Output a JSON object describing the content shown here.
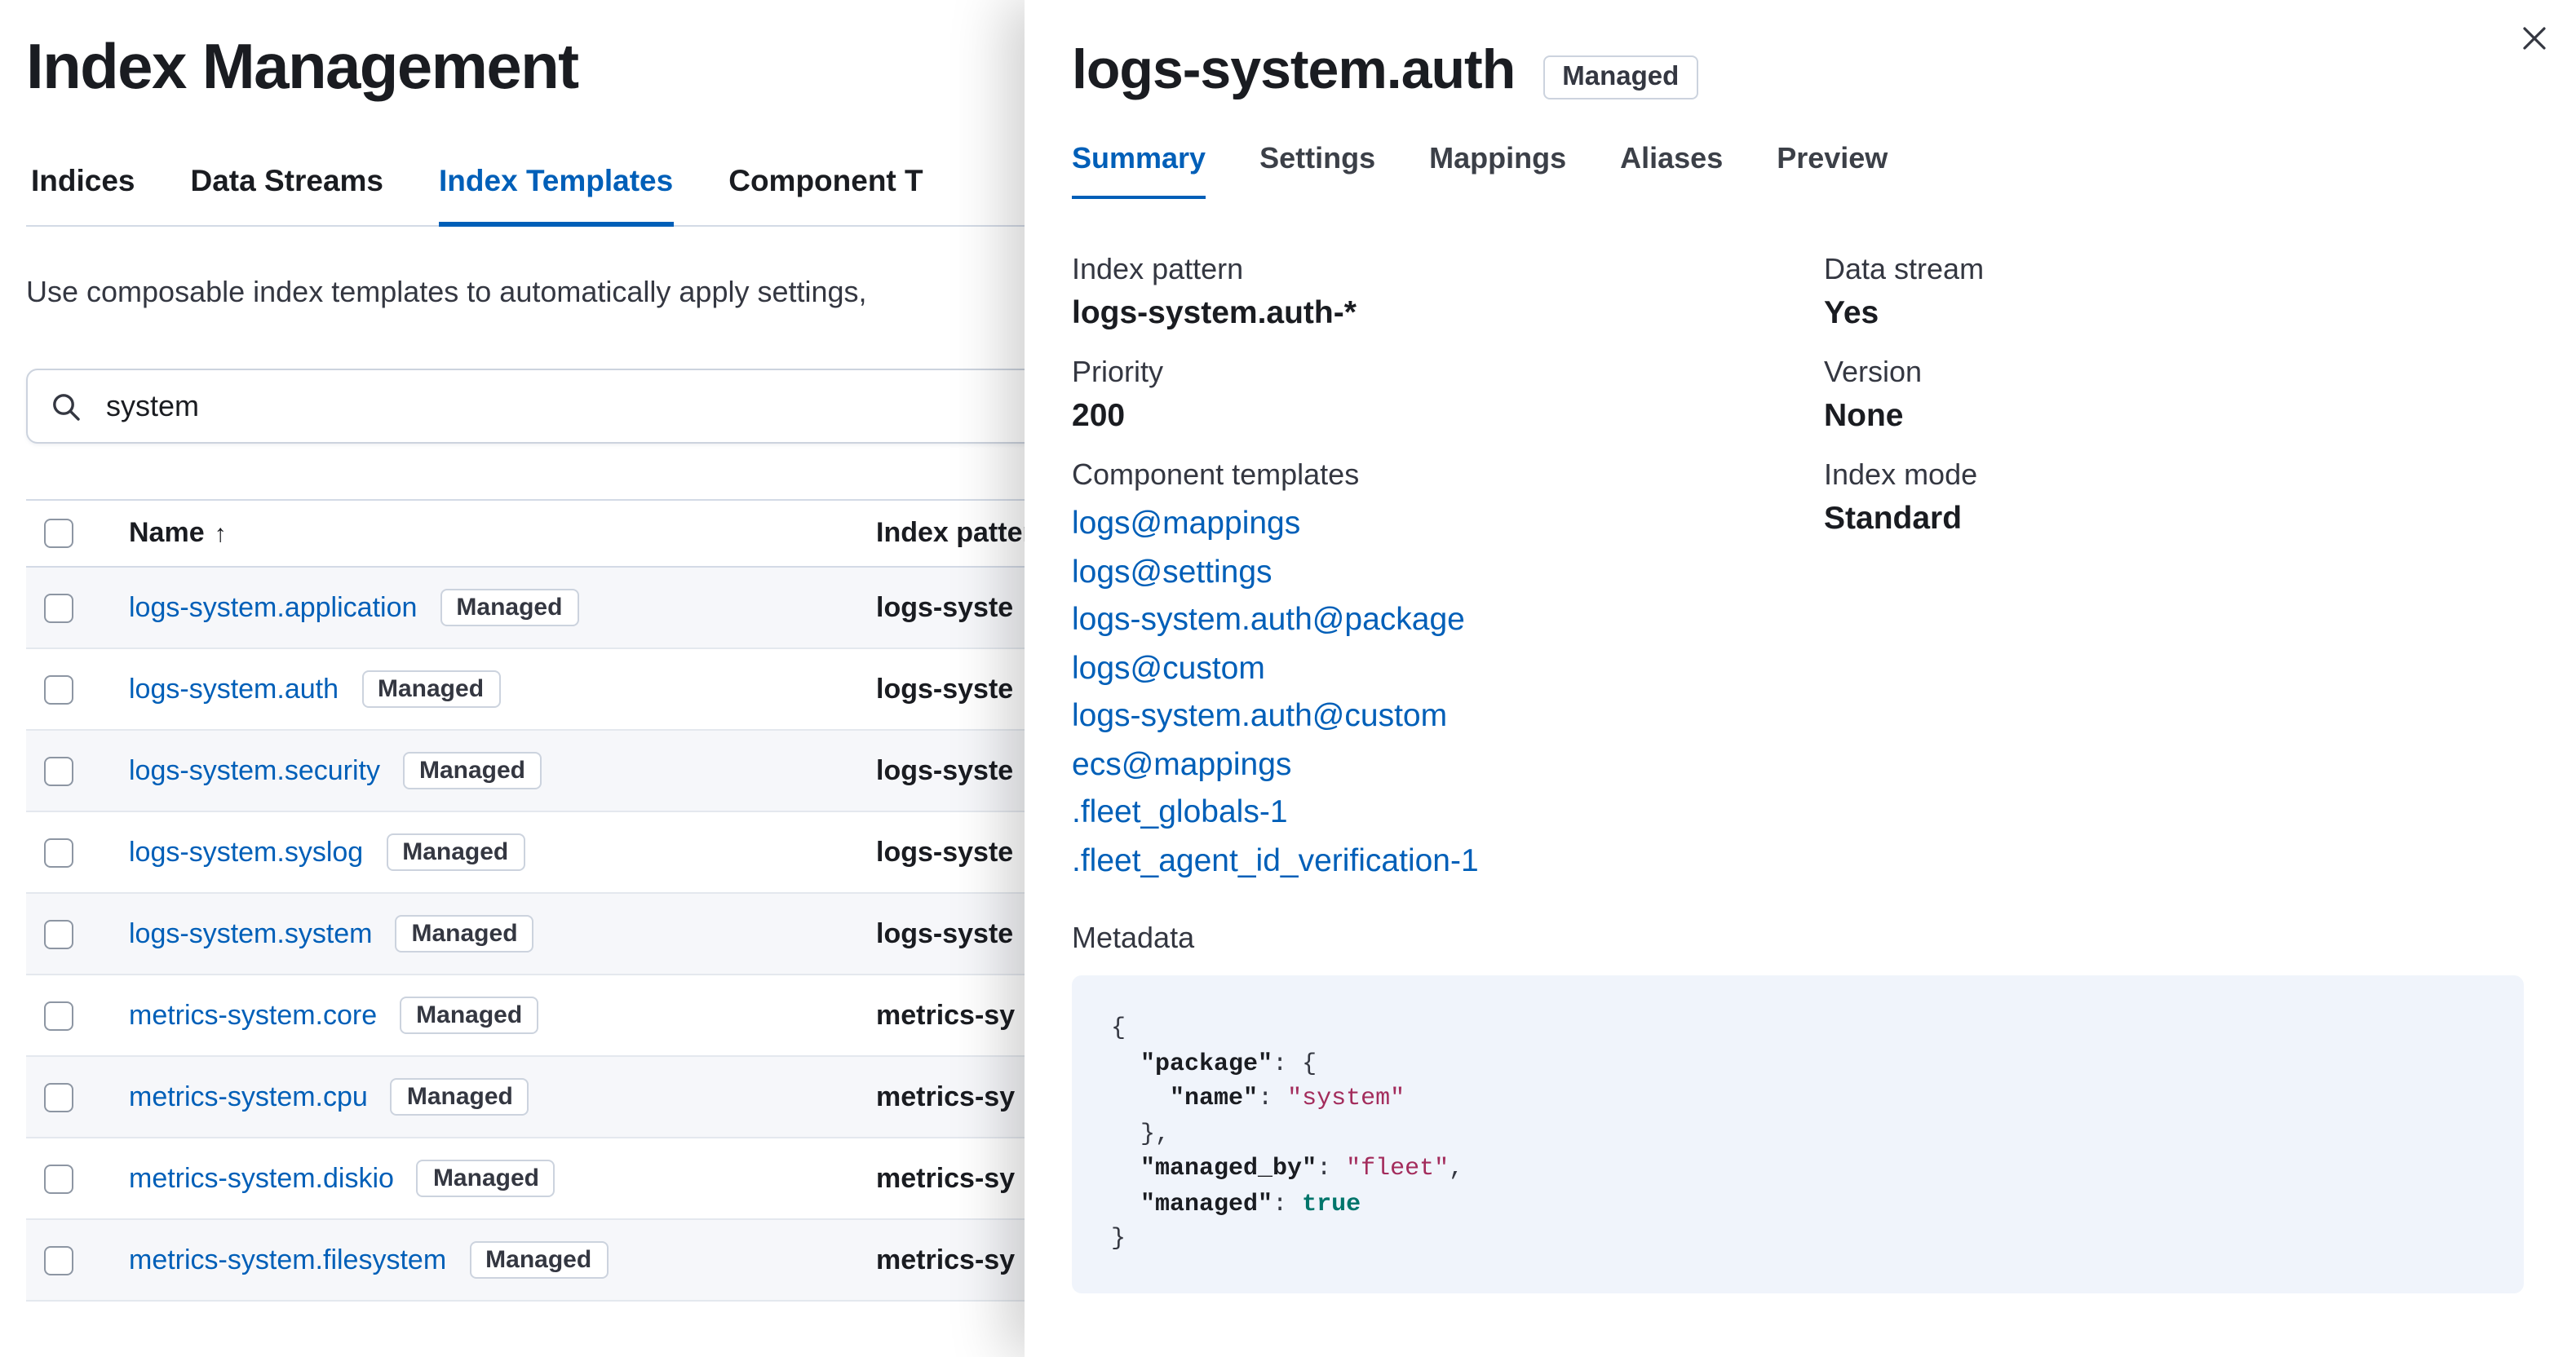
{
  "colors": {
    "accent": "#005fb8",
    "text": "#1a1c21",
    "subdued": "#343741",
    "border": "#d3dae6",
    "badge-border": "#ccd3de",
    "code-bg": "#f0f4fb",
    "code-str": "#a32c5c",
    "code-bool": "#00756b"
  },
  "page": {
    "title": "Index Management",
    "tabs": [
      {
        "label": "Indices"
      },
      {
        "label": "Data Streams"
      },
      {
        "label": "Index Templates"
      },
      {
        "label": "Component T"
      }
    ],
    "description": "Use composable index templates to automatically apply settings,",
    "search": {
      "value": "system"
    },
    "table": {
      "headers": {
        "name": "Name",
        "pattern": "Index patter"
      },
      "rows": [
        {
          "name": "logs-system.application",
          "badge": "Managed",
          "pattern": "logs-syste"
        },
        {
          "name": "logs-system.auth",
          "badge": "Managed",
          "pattern": "logs-syste"
        },
        {
          "name": "logs-system.security",
          "badge": "Managed",
          "pattern": "logs-syste"
        },
        {
          "name": "logs-system.syslog",
          "badge": "Managed",
          "pattern": "logs-syste"
        },
        {
          "name": "logs-system.system",
          "badge": "Managed",
          "pattern": "logs-syste"
        },
        {
          "name": "metrics-system.core",
          "badge": "Managed",
          "pattern": "metrics-sy"
        },
        {
          "name": "metrics-system.cpu",
          "badge": "Managed",
          "pattern": "metrics-sy"
        },
        {
          "name": "metrics-system.diskio",
          "badge": "Managed",
          "pattern": "metrics-sy"
        },
        {
          "name": "metrics-system.filesystem",
          "badge": "Managed",
          "pattern": "metrics-sy"
        }
      ]
    }
  },
  "flyout": {
    "title": "logs-system.auth",
    "badge": "Managed",
    "tabs": [
      {
        "label": "Summary"
      },
      {
        "label": "Settings"
      },
      {
        "label": "Mappings"
      },
      {
        "label": "Aliases"
      },
      {
        "label": "Preview"
      }
    ],
    "summary": {
      "index_pattern_label": "Index pattern",
      "index_pattern_value": "logs-system.auth-*",
      "priority_label": "Priority",
      "priority_value": "200",
      "component_templates_label": "Component templates",
      "component_templates": [
        "logs@mappings",
        "logs@settings",
        "logs-system.auth@package",
        "logs@custom",
        "logs-system.auth@custom",
        "ecs@mappings",
        ".fleet_globals-1",
        ".fleet_agent_id_verification-1"
      ],
      "data_stream_label": "Data stream",
      "data_stream_value": "Yes",
      "version_label": "Version",
      "version_value": "None",
      "index_mode_label": "Index mode",
      "index_mode_value": "Standard",
      "metadata_label": "Metadata",
      "metadata_lines": [
        [
          {
            "t": "{"
          }
        ],
        [
          {
            "t": "  "
          },
          {
            "t": "\"package\"",
            "c": "key"
          },
          {
            "t": ": {"
          }
        ],
        [
          {
            "t": "    "
          },
          {
            "t": "\"name\"",
            "c": "key"
          },
          {
            "t": ": "
          },
          {
            "t": "\"system\"",
            "c": "str"
          }
        ],
        [
          {
            "t": "  },"
          }
        ],
        [
          {
            "t": "  "
          },
          {
            "t": "\"managed_by\"",
            "c": "key"
          },
          {
            "t": ": "
          },
          {
            "t": "\"fleet\"",
            "c": "str"
          },
          {
            "t": ","
          }
        ],
        [
          {
            "t": "  "
          },
          {
            "t": "\"managed\"",
            "c": "key"
          },
          {
            "t": ": "
          },
          {
            "t": "true",
            "c": "bool"
          }
        ],
        [
          {
            "t": "}"
          }
        ]
      ]
    }
  }
}
